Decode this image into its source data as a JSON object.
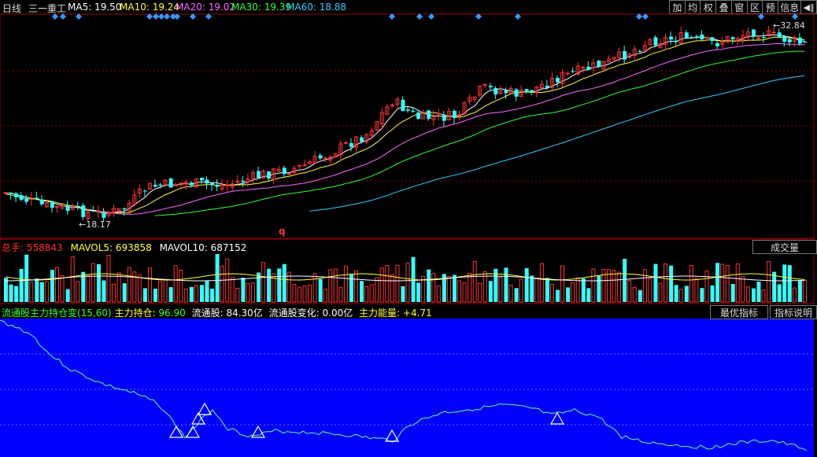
{
  "header": {
    "period": "日线",
    "stock_name": "三一重工",
    "ma": [
      {
        "label": "MA5: 19.50",
        "color": "#ffffff"
      },
      {
        "label": "MA10: 19.24",
        "color": "#ffff33"
      },
      {
        "label": "MA20: 19.02",
        "color": "#ff66ff"
      },
      {
        "label": "MA30: 19.39",
        "color": "#33ff33"
      },
      {
        "label": "MA60: 18.88",
        "color": "#33ccff"
      }
    ]
  },
  "toolbar": [
    "加",
    "均",
    "权",
    "叠",
    "窗",
    "区",
    "预",
    "信息"
  ],
  "toolbar_icon": "arrow-left-icon",
  "price_chart": {
    "high_label": "32.84",
    "low_label": "18.17",
    "marker_text": "q",
    "grid": true
  },
  "volume_panel": {
    "title_label": "总手: ",
    "title_value": "558843",
    "mavol5": "MAVOL5: 693858",
    "mavol10": "MAVOL10: 687152",
    "button": "成交量"
  },
  "indicator_panel": {
    "name": "流通股主力持仓变(15,60)",
    "holding_label": "主力持仓: ",
    "holding_value": "96.90",
    "float_shares": "流通股: 84.30亿",
    "float_change": "流通股变化: 0.00亿",
    "energy_label": "主力能量: ",
    "energy_value": "+4.71",
    "buttons": [
      "最优指标",
      "指标说明"
    ],
    "background": "#0000ff"
  },
  "colors": {
    "up": "#ff3333",
    "down": "#33ffff",
    "ma5": "#ffffff",
    "ma10": "#ffff33",
    "ma20": "#ff66ff",
    "ma30": "#33ff33",
    "ma60": "#33ccff",
    "grid": "#8b0000",
    "signal": "#3399ff"
  }
}
